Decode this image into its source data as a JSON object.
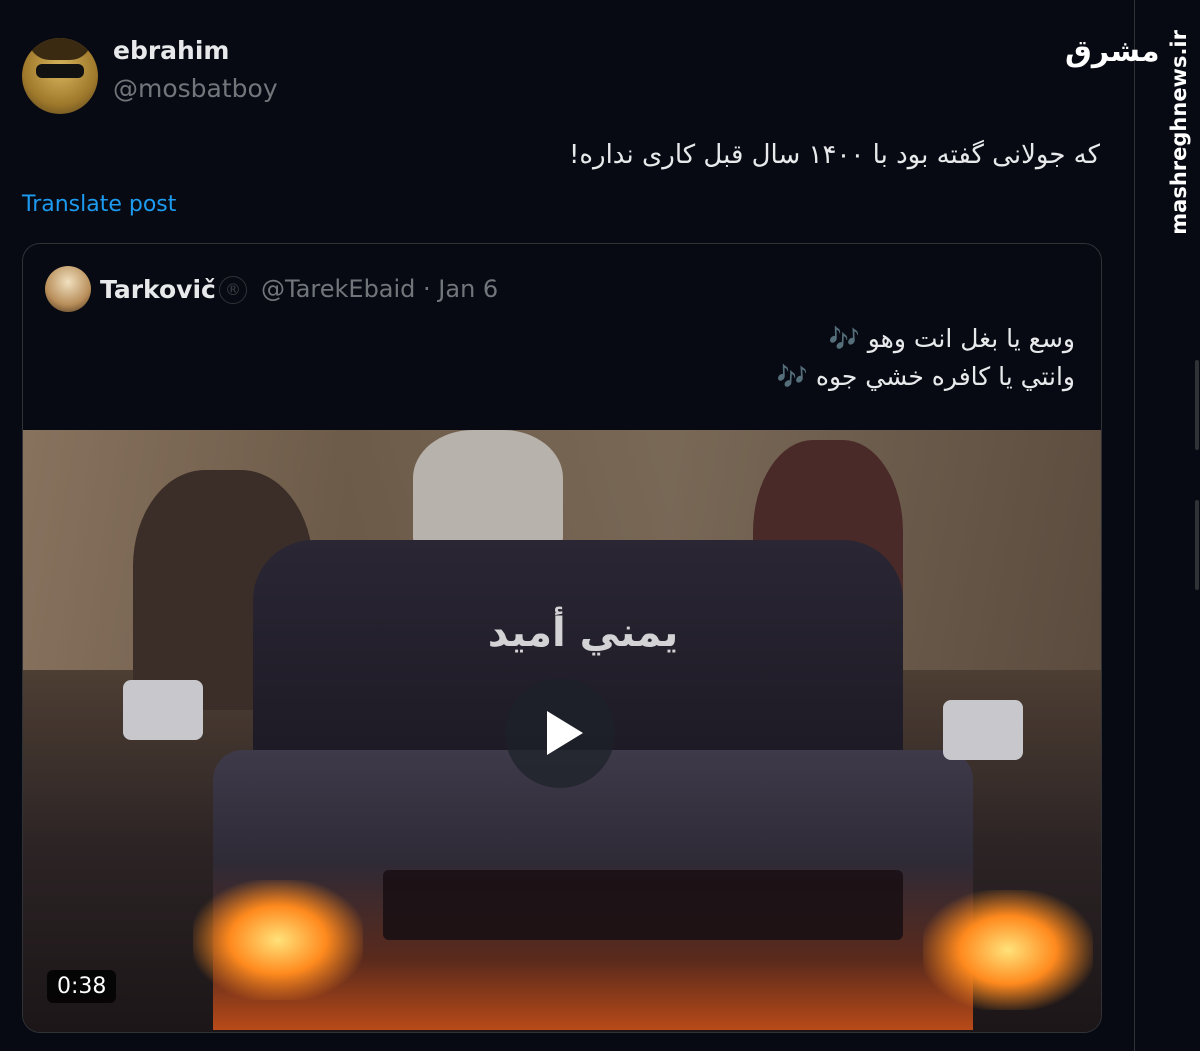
{
  "post": {
    "author_name": "ebrahim",
    "author_handle": "@mosbatboy",
    "text": "که جولانی گفته بود با ۱۴۰۰ سال قبل کاری نداره!",
    "translate_label": "Translate post"
  },
  "quote": {
    "author_name": "Tarkovič",
    "badge": "®",
    "handle_and_date": "@TarekEbaid · Jan 6",
    "line1": "وسع يا بغل انت وهو",
    "line2": "وانتي يا كافره خشي جوه",
    "note_emoji": "🎶",
    "video": {
      "windshield_text": "يمني أميد",
      "duration": "0:38",
      "play_icon": "play-icon"
    }
  },
  "watermark": {
    "logo": "مشرق",
    "url": "mashreghnews.ir"
  },
  "colors": {
    "background": "#070a13",
    "link": "#1d9bf0",
    "muted": "#71767b",
    "text": "#e7e9ea"
  }
}
